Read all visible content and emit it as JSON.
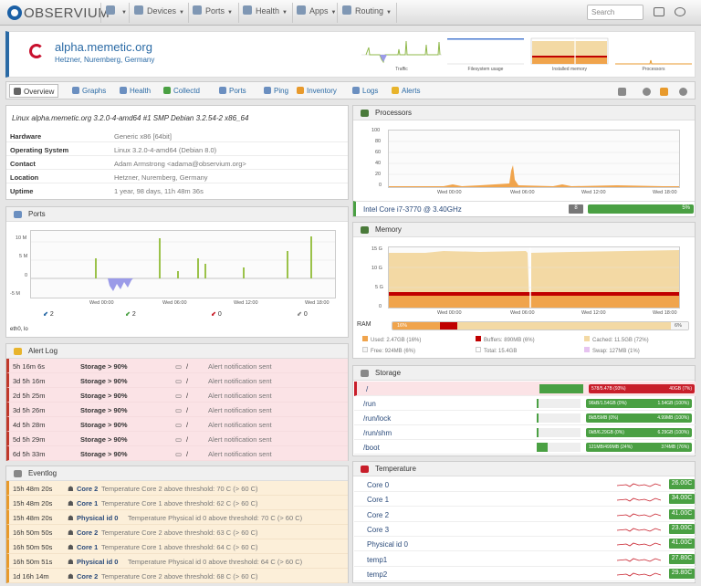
{
  "nav": {
    "logo": "OBSERVIUM",
    "devices": "Devices",
    "ports": "Ports",
    "health": "Health",
    "apps": "Apps",
    "routing": "Routing",
    "search_placeholder": "Search"
  },
  "device": {
    "hostname": "alpha.memetic.org",
    "location": "Hetzner, Nuremberg, Germany",
    "sparks": [
      "Traffic",
      "Filesystem usage",
      "Installed memory",
      "Processors"
    ]
  },
  "tabs": [
    "Overview",
    "Graphs",
    "Health",
    "Collectd",
    "Ports",
    "Ping",
    "Inventory",
    "Logs",
    "Alerts"
  ],
  "overview": {
    "sysdescr": "Linux alpha.memetic.org 3.2.0-4-amd64 #1 SMP Debian 3.2.54-2 x86_64",
    "rows": [
      {
        "label": "Hardware",
        "value": "Generic x86 [64bit]"
      },
      {
        "label": "Operating System",
        "value": "Linux 3.2.0-4-amd64 (Debian 8.0)"
      },
      {
        "label": "Contact",
        "value": "Adam Armstrong <adama@observium.org>"
      },
      {
        "label": "Location",
        "value": "Hetzner, Nuremberg, Germany"
      },
      {
        "label": "Uptime",
        "value": "1 year, 98 days, 11h 48m 36s"
      }
    ]
  },
  "ports_panel": {
    "title": "Ports",
    "y_ticks": [
      "10 M",
      "5 M",
      "0",
      "-5 M"
    ],
    "x_ticks": [
      "Wed 00:00",
      "Wed 06:00",
      "Wed 12:00",
      "Wed 18:00"
    ],
    "counts": [
      "2",
      "2",
      "0",
      "0"
    ],
    "port_name": "eth0, lo"
  },
  "alert_log": {
    "title": "Alert Log",
    "rows": [
      {
        "time": "5h 16m 6s",
        "entity": "Storage > 90%",
        "path": "/",
        "msg": "Alert notification sent"
      },
      {
        "time": "3d 5h 16m",
        "entity": "Storage > 90%",
        "path": "/",
        "msg": "Alert notification sent"
      },
      {
        "time": "2d 5h 25m",
        "entity": "Storage > 90%",
        "path": "/",
        "msg": "Alert notification sent"
      },
      {
        "time": "3d 5h 26m",
        "entity": "Storage > 90%",
        "path": "/",
        "msg": "Alert notification sent"
      },
      {
        "time": "4d 5h 28m",
        "entity": "Storage > 90%",
        "path": "/",
        "msg": "Alert notification sent"
      },
      {
        "time": "5d 5h 29m",
        "entity": "Storage > 90%",
        "path": "/",
        "msg": "Alert notification sent"
      },
      {
        "time": "6d 5h 33m",
        "entity": "Storage > 90%",
        "path": "/",
        "msg": "Alert notification sent"
      }
    ]
  },
  "eventlog": {
    "title": "Eventlog",
    "rows": [
      {
        "time": "15h 48m 20s",
        "entity": "Core 2",
        "msg": "Temperature Core 2 above threshold: 70 C (> 60 C)"
      },
      {
        "time": "15h 48m 20s",
        "entity": "Core 1",
        "msg": "Temperature Core 1 above threshold: 62 C (> 60 C)"
      },
      {
        "time": "15h 48m 20s",
        "entity": "Physical id 0",
        "msg": "Temperature Physical id 0 above threshold: 70 C (> 60 C)"
      },
      {
        "time": "16h 50m 50s",
        "entity": "Core 2",
        "msg": "Temperature Core 2 above threshold: 63 C (> 60 C)"
      },
      {
        "time": "16h 50m 50s",
        "entity": "Core 1",
        "msg": "Temperature Core 1 above threshold: 64 C (> 60 C)"
      },
      {
        "time": "16h 50m 51s",
        "entity": "Physical id 0",
        "msg": "Temperature Physical id 0 above threshold: 64 C (> 60 C)"
      },
      {
        "time": "1d 16h 14m",
        "entity": "Core 2",
        "msg": "Temperature Core 2 above threshold: 68 C (> 60 C)"
      }
    ]
  },
  "processors": {
    "title": "Processors",
    "y_ticks": [
      "100",
      "80",
      "60",
      "40",
      "20",
      "0"
    ],
    "x_ticks": [
      "Wed 00:00",
      "Wed 06:00",
      "Wed 12:00",
      "Wed 18:00"
    ],
    "cpu_name": "Intel Core i7-3770 @ 3.40GHz",
    "cpu_count": "8",
    "cpu_usage": "5%",
    "cpu_usage_fraction": 0.05
  },
  "memory": {
    "title": "Memory",
    "y_ticks": [
      "15 G",
      "10 G",
      "5 G",
      "0"
    ],
    "x_ticks": [
      "Wed 00:00",
      "Wed 06:00",
      "Wed 12:00",
      "Wed 18:00"
    ],
    "ram_label": "RAM",
    "ram_used_pct": "16%",
    "ram_free_pct": "6%",
    "segments": [
      {
        "fraction": 0.16,
        "color": "#f0a44c"
      },
      {
        "fraction": 0.06,
        "color": "#c00000"
      },
      {
        "fraction": 0.72,
        "color": "#f3d9a4"
      },
      {
        "fraction": 0.06,
        "color": "#f5f5f5"
      }
    ],
    "legend": [
      {
        "text": "Used: 2.47GB (16%)",
        "color": "#f0a44c"
      },
      {
        "text": "Buffers: 890MB (6%)",
        "color": "#c00000"
      },
      {
        "text": "Cached: 11.5GB (72%)",
        "color": "#f3d9a4"
      },
      {
        "text": "Free: 924MB (6%)",
        "color": "#f5f5f5"
      },
      {
        "text": "Total: 15.4GB",
        "color": "#ffffff"
      },
      {
        "text": "Swap: 127MB (1%)",
        "color": "#e6c3f0"
      }
    ]
  },
  "storage": {
    "title": "Storage",
    "rows": [
      {
        "name": "/",
        "usage": "578/5.47B (93%)",
        "free": "40GB (7%)",
        "fraction": 0.93,
        "color": "#c81e2a",
        "alert": true
      },
      {
        "name": "/run",
        "usage": "96kB/1.54GB (0%)",
        "free": "1.54GB (100%)",
        "fraction": 0.0,
        "color": "#4aa043",
        "alert": false
      },
      {
        "name": "/run/lock",
        "usage": "8kB/5MB (0%)",
        "free": "4.99MB (100%)",
        "fraction": 0.0,
        "color": "#4aa043",
        "alert": false
      },
      {
        "name": "/run/shm",
        "usage": "0kB/6.29GB (0%)",
        "free": "6.29GB (100%)",
        "fraction": 0.0,
        "color": "#4aa043",
        "alert": false
      },
      {
        "name": "/boot",
        "usage": "121MB/499MB (24%)",
        "free": "374MB (76%)",
        "fraction": 0.24,
        "color": "#4aa043",
        "alert": false
      }
    ]
  },
  "temperature": {
    "title": "Temperature",
    "rows": [
      {
        "name": "Core 0",
        "value": "26.00C"
      },
      {
        "name": "Core 1",
        "value": "34.00C"
      },
      {
        "name": "Core 2",
        "value": "41.00C"
      },
      {
        "name": "Core 3",
        "value": "23.00C"
      },
      {
        "name": "Physical id 0",
        "value": "41.00C"
      },
      {
        "name": "temp1",
        "value": "27.80C"
      },
      {
        "name": "temp2",
        "value": "29.80C"
      }
    ]
  },
  "colors": {
    "accent": "#2a6aa5",
    "ok": "#4aa043",
    "alert": "#c81e2a",
    "warn": "#e89a2c"
  }
}
